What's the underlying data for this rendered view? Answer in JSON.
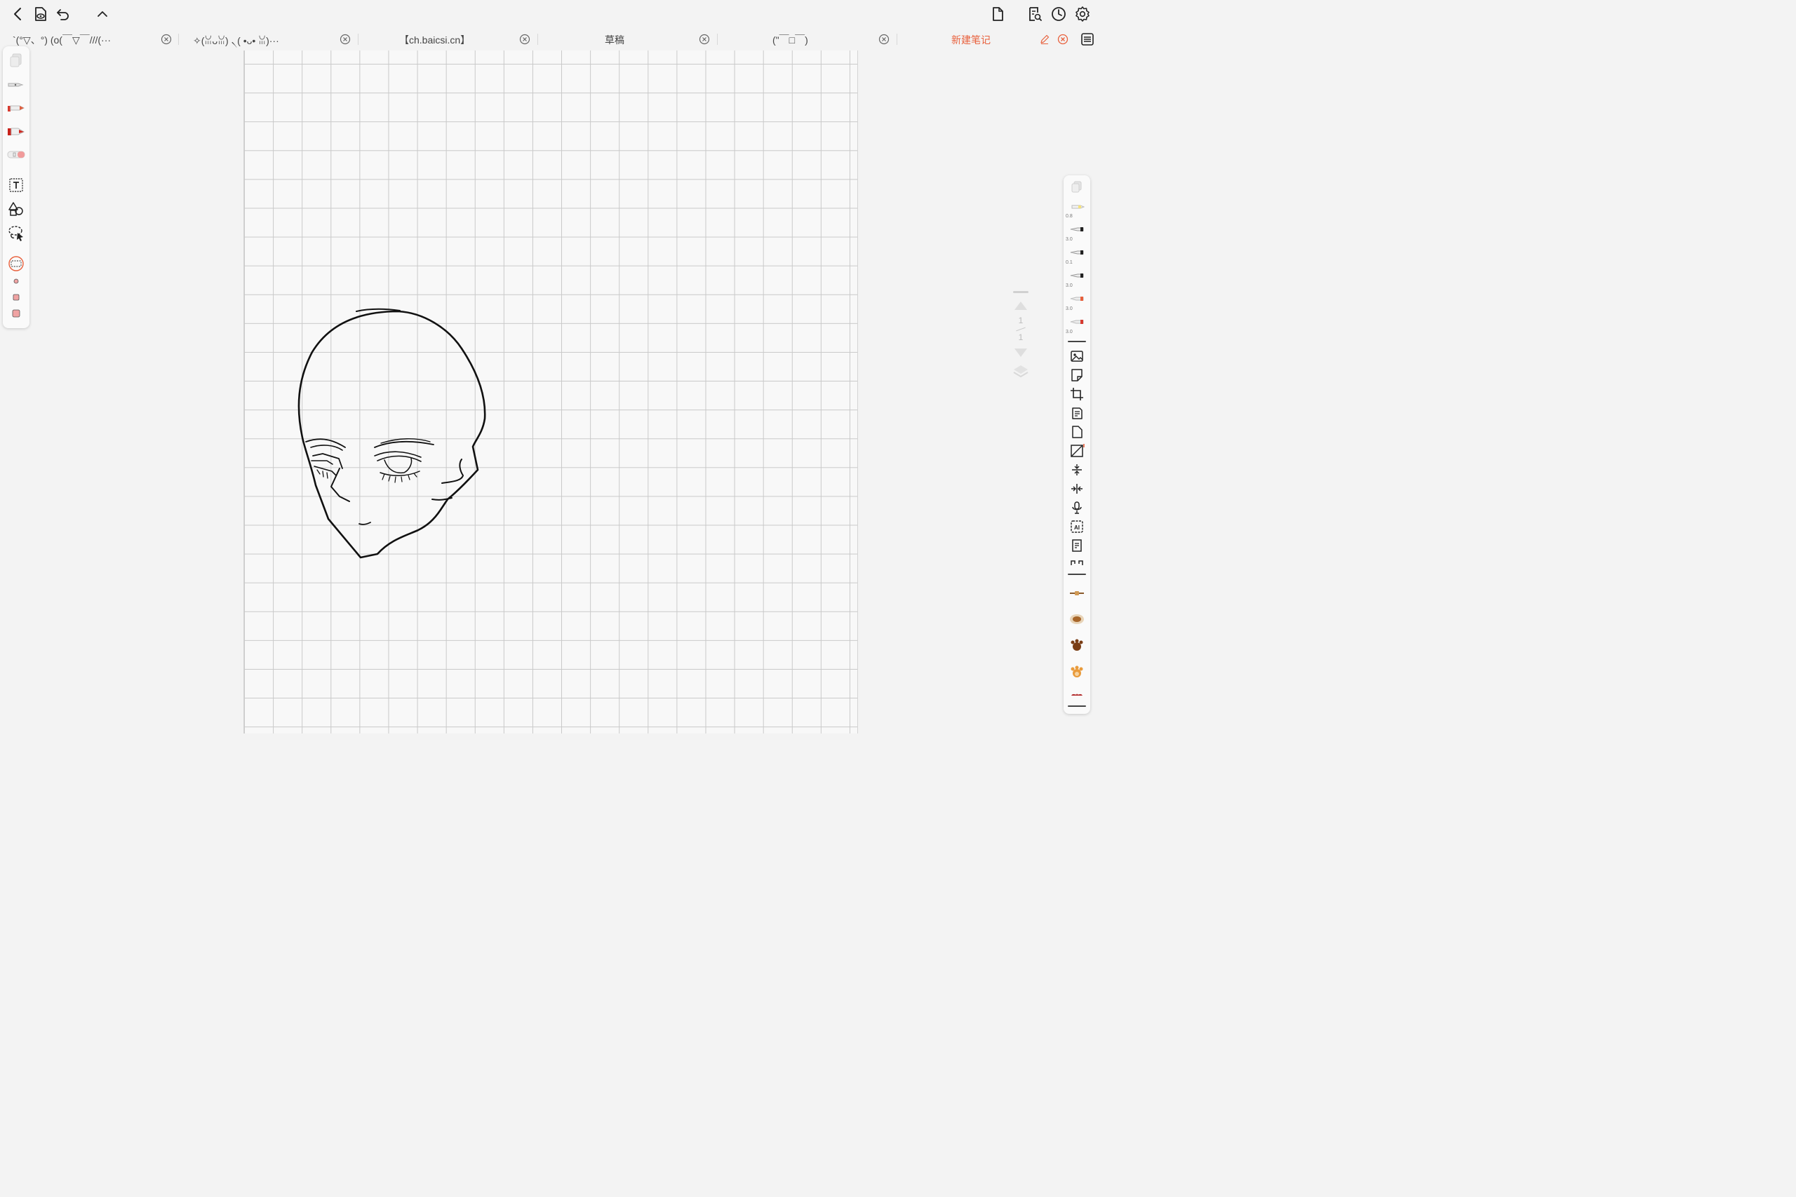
{
  "topbar": {
    "left_icons": [
      "back-icon",
      "reading-mode-icon",
      "undo-icon",
      "collapse-icon"
    ],
    "right_icons": [
      "new-page-icon",
      "search-note-icon",
      "history-icon",
      "settings-icon"
    ]
  },
  "tabs": [
    {
      "label": "`(°▽、°) (o(￣▽￣///(···"
    },
    {
      "label": "✧(ꈍᴗꈍ) ৲( •ᴗ• ꈍ)···"
    },
    {
      "label": "【ch.baicsi.cn】"
    },
    {
      "label": "草稿"
    },
    {
      "label": "(\"￣□￣)"
    },
    {
      "label": "新建笔记",
      "active": true
    }
  ],
  "right_toolbar": {
    "pen_sizes": [
      "0.8",
      "3.0",
      "0.1",
      "3.0",
      "3.0",
      "3.0"
    ]
  },
  "page_nav": {
    "current": "1",
    "total": "1"
  },
  "colors": {
    "accent": "#e8603c",
    "paper": "#f8f8f8",
    "grid": "#c9c9c9"
  }
}
